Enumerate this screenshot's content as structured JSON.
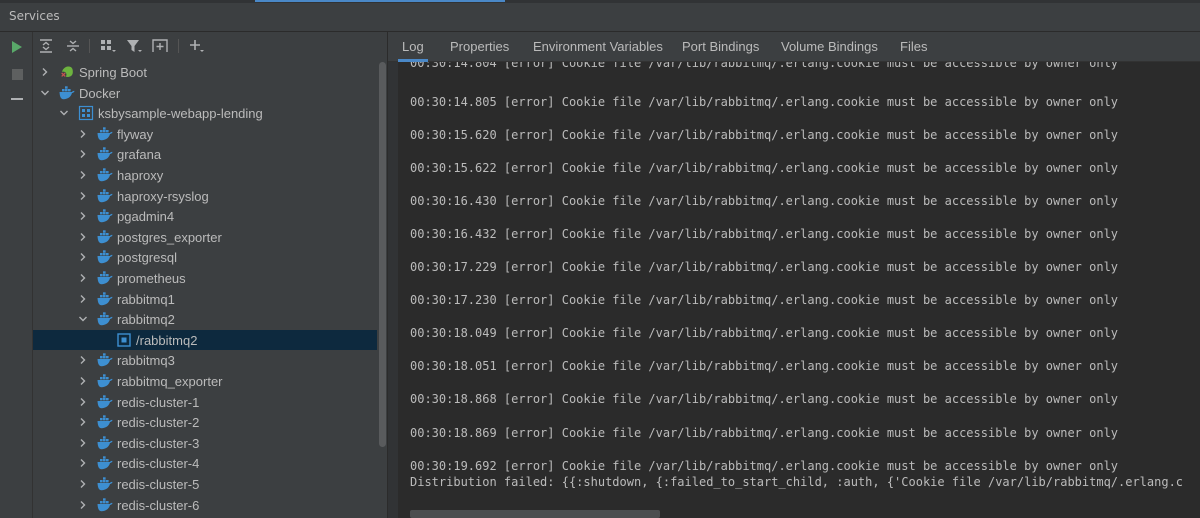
{
  "window": {
    "title": "Services"
  },
  "tree": {
    "items": [
      {
        "label": "Spring Boot",
        "depth": 0,
        "expanded": false,
        "icon": "spring-boot-icon"
      },
      {
        "label": "Docker",
        "depth": 0,
        "expanded": true,
        "icon": "docker-icon"
      },
      {
        "label": "ksbysample-webapp-lending",
        "depth": 1,
        "expanded": true,
        "icon": "compose-icon"
      },
      {
        "label": "flyway",
        "depth": 2,
        "expanded": false,
        "icon": "docker-icon"
      },
      {
        "label": "grafana",
        "depth": 2,
        "expanded": false,
        "icon": "docker-icon"
      },
      {
        "label": "haproxy",
        "depth": 2,
        "expanded": false,
        "icon": "docker-icon"
      },
      {
        "label": "haproxy-rsyslog",
        "depth": 2,
        "expanded": false,
        "icon": "docker-icon"
      },
      {
        "label": "pgadmin4",
        "depth": 2,
        "expanded": false,
        "icon": "docker-icon"
      },
      {
        "label": "postgres_exporter",
        "depth": 2,
        "expanded": false,
        "icon": "docker-icon"
      },
      {
        "label": "postgresql",
        "depth": 2,
        "expanded": false,
        "icon": "docker-icon"
      },
      {
        "label": "prometheus",
        "depth": 2,
        "expanded": false,
        "icon": "docker-icon"
      },
      {
        "label": "rabbitmq1",
        "depth": 2,
        "expanded": false,
        "icon": "docker-icon"
      },
      {
        "label": "rabbitmq2",
        "depth": 2,
        "expanded": true,
        "icon": "docker-icon"
      },
      {
        "label": "/rabbitmq2",
        "depth": 3,
        "leaf": true,
        "selected": true,
        "icon": "container-icon"
      },
      {
        "label": "rabbitmq3",
        "depth": 2,
        "expanded": false,
        "icon": "docker-icon"
      },
      {
        "label": "rabbitmq_exporter",
        "depth": 2,
        "expanded": false,
        "icon": "docker-icon"
      },
      {
        "label": "redis-cluster-1",
        "depth": 2,
        "expanded": false,
        "icon": "docker-icon"
      },
      {
        "label": "redis-cluster-2",
        "depth": 2,
        "expanded": false,
        "icon": "docker-icon"
      },
      {
        "label": "redis-cluster-3",
        "depth": 2,
        "expanded": false,
        "icon": "docker-icon"
      },
      {
        "label": "redis-cluster-4",
        "depth": 2,
        "expanded": false,
        "icon": "docker-icon"
      },
      {
        "label": "redis-cluster-5",
        "depth": 2,
        "expanded": false,
        "icon": "docker-icon"
      },
      {
        "label": "redis-cluster-6",
        "depth": 2,
        "expanded": false,
        "icon": "docker-icon"
      }
    ]
  },
  "tabs": [
    {
      "label": "Log",
      "active": true
    },
    {
      "label": "Properties"
    },
    {
      "label": "Environment Variables"
    },
    {
      "label": "Port Bindings"
    },
    {
      "label": "Volume Bindings"
    },
    {
      "label": "Files"
    }
  ],
  "log": {
    "top_partial": "00:30:14.804 [error] Cookie file /var/lib/rabbitmq/.erlang.cookie must be accessible by owner only",
    "lines": [
      "00:30:14.805 [error] Cookie file /var/lib/rabbitmq/.erlang.cookie must be accessible by owner only",
      "00:30:15.620 [error] Cookie file /var/lib/rabbitmq/.erlang.cookie must be accessible by owner only",
      "00:30:15.622 [error] Cookie file /var/lib/rabbitmq/.erlang.cookie must be accessible by owner only",
      "00:30:16.430 [error] Cookie file /var/lib/rabbitmq/.erlang.cookie must be accessible by owner only",
      "00:30:16.432 [error] Cookie file /var/lib/rabbitmq/.erlang.cookie must be accessible by owner only",
      "00:30:17.229 [error] Cookie file /var/lib/rabbitmq/.erlang.cookie must be accessible by owner only",
      "00:30:17.230 [error] Cookie file /var/lib/rabbitmq/.erlang.cookie must be accessible by owner only",
      "00:30:18.049 [error] Cookie file /var/lib/rabbitmq/.erlang.cookie must be accessible by owner only",
      "00:30:18.051 [error] Cookie file /var/lib/rabbitmq/.erlang.cookie must be accessible by owner only",
      "00:30:18.868 [error] Cookie file /var/lib/rabbitmq/.erlang.cookie must be accessible by owner only",
      "00:30:18.869 [error] Cookie file /var/lib/rabbitmq/.erlang.cookie must be accessible by owner only",
      "00:30:19.692 [error] Cookie file /var/lib/rabbitmq/.erlang.cookie must be accessible by owner only"
    ],
    "final_line": "Distribution failed: {{:shutdown, {:failed_to_start_child, :auth, {'Cookie file /var/lib/rabbitmq/.erlang.c"
  },
  "colors": {
    "accent": "#4a88c7",
    "run_green": "#59a869",
    "docker_blue": "#3d8fd1",
    "selection": "#0d293e"
  }
}
